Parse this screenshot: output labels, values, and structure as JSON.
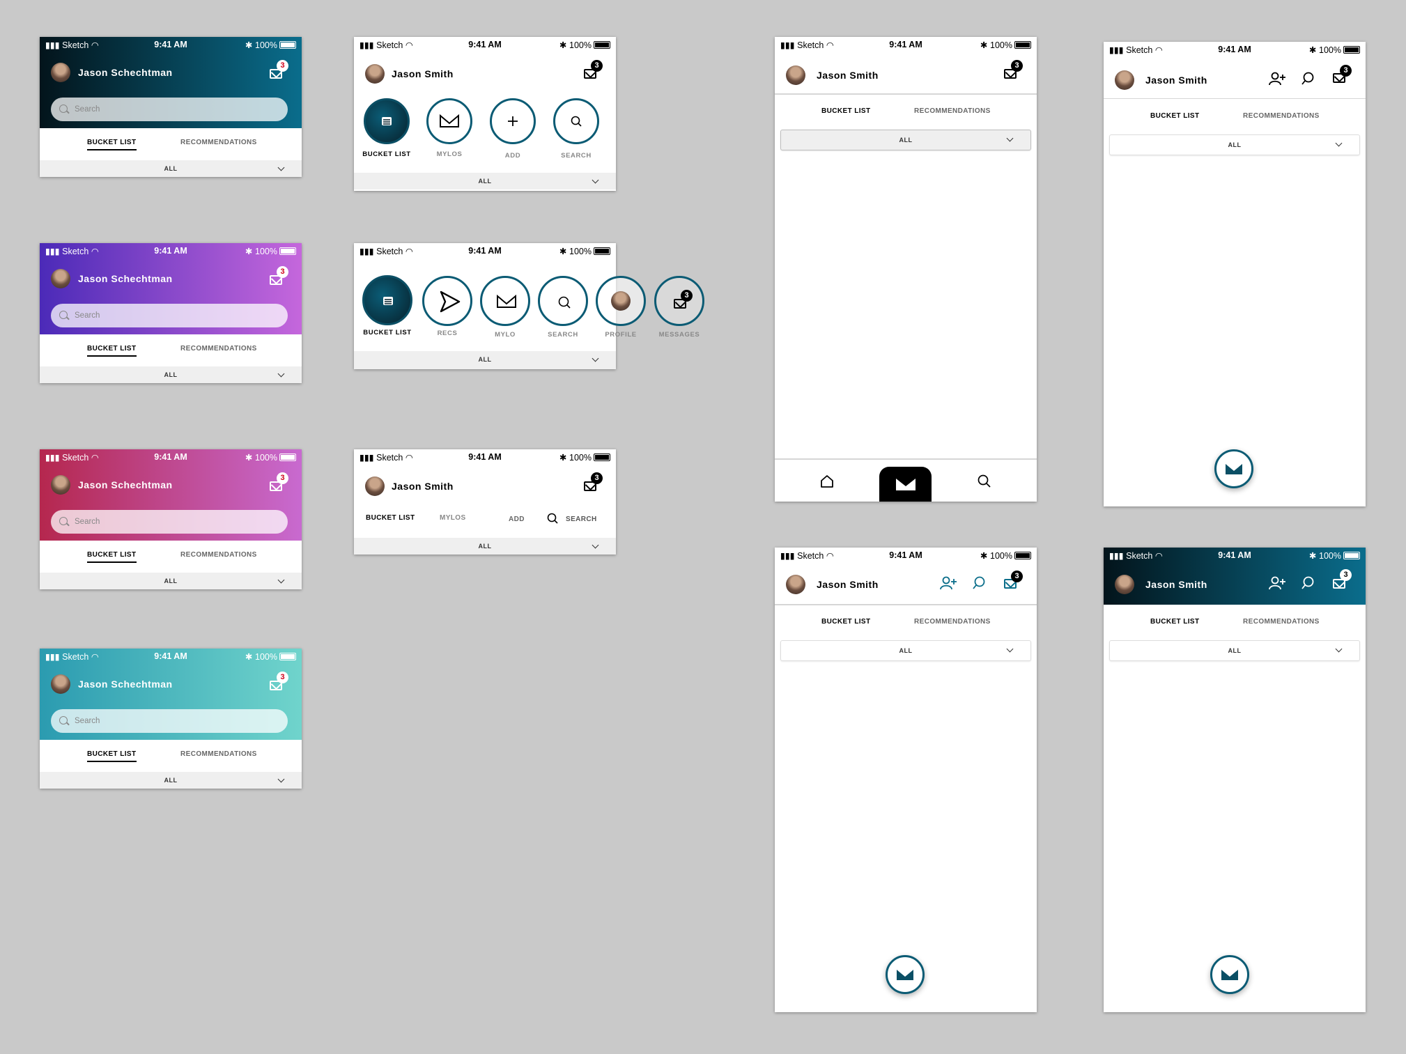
{
  "status": {
    "carrier": "Sketch",
    "time": "9:41 AM",
    "battery": "100%"
  },
  "user": {
    "full": "Jason Schechtman",
    "short": "Jason Smith"
  },
  "badge": "3",
  "search_placeholder": "Search",
  "tabs": {
    "bucket": "BUCKET LIST",
    "recs": "RECOMMENDATIONS"
  },
  "filter": "ALL",
  "nav": {
    "bucket": "BUCKET LIST",
    "mylos": "MYLOS",
    "add": "ADD",
    "search": "SEARCH",
    "recs": "RECS",
    "mylo": "MYLO",
    "profile": "PROFILE",
    "messages": "MESSAGES"
  },
  "colors": {
    "teal_dark": "#0b5b74",
    "gradients": [
      "#000000-#0a6d8c",
      "#4b2ab8-#c567dc",
      "#b5274e-#c86ad0",
      "#2b9bb0-#70d4cc"
    ]
  }
}
